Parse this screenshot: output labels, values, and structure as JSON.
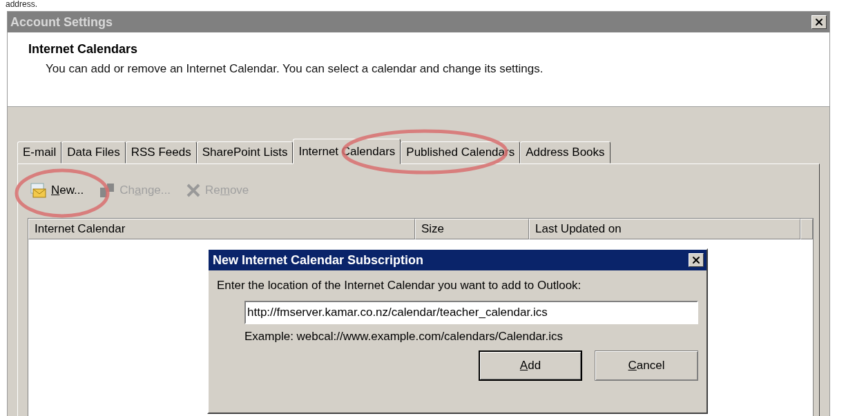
{
  "page_caption": "address.",
  "window": {
    "title": "Account Settings"
  },
  "header": {
    "title": "Internet Calendars",
    "description": "You can add or remove an Internet Calendar. You can select a calendar and change its settings."
  },
  "tabs": [
    {
      "label": "E-mail",
      "selected": false
    },
    {
      "label": "Data Files",
      "selected": false
    },
    {
      "label": "RSS Feeds",
      "selected": false
    },
    {
      "label": "SharePoint Lists",
      "selected": false
    },
    {
      "label": "Internet Calendars",
      "selected": true
    },
    {
      "label": "Published Calendars",
      "selected": false
    },
    {
      "label": "Address Books",
      "selected": false
    }
  ],
  "toolbar": [
    {
      "kind": "new",
      "label": [
        {
          "text": "N",
          "underline": true
        },
        {
          "text": "ew...",
          "underline": false
        }
      ],
      "disabled": false
    },
    {
      "kind": "change",
      "label": [
        {
          "text": "Ch",
          "underline": false
        },
        {
          "text": "a",
          "underline": true
        },
        {
          "text": "nge...",
          "underline": false
        }
      ],
      "disabled": true
    },
    {
      "kind": "remove",
      "label": [
        {
          "text": "Re",
          "underline": false
        },
        {
          "text": "m",
          "underline": true
        },
        {
          "text": "ove",
          "underline": false
        }
      ],
      "disabled": true
    }
  ],
  "table": {
    "columns": [
      "Internet Calendar",
      "Size",
      "Last Updated on"
    ]
  },
  "dialog": {
    "title": "New Internet Calendar Subscription",
    "prompt": "Enter the location of the Internet Calendar you want to add to Outlook:",
    "value": "http://fmserver.kamar.co.nz/calendar/teacher_calendar.ics",
    "example": "Example: webcal://www.example.com/calendars/Calendar.ics",
    "buttons": [
      {
        "label": [
          {
            "text": "A",
            "underline": true
          },
          {
            "text": "dd",
            "underline": false
          }
        ],
        "default": true
      },
      {
        "label": [
          {
            "text": "C",
            "underline": true
          },
          {
            "text": "ancel",
            "underline": false
          }
        ],
        "default": false
      }
    ]
  }
}
